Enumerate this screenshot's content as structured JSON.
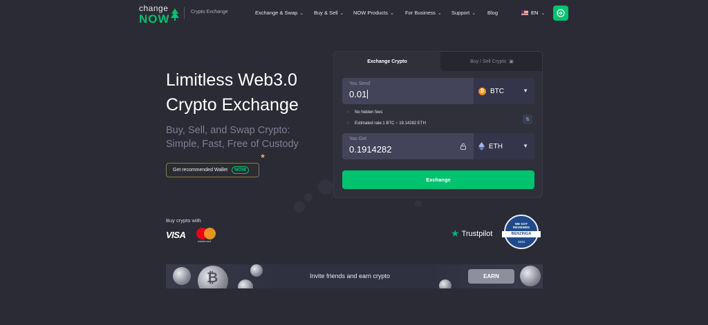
{
  "brand": {
    "logo_top": "change",
    "logo_bottom": "NOW",
    "tagline": "Crypto Exchange",
    "accent_color": "#00c26f"
  },
  "nav": {
    "items": [
      {
        "label": "Exchange & Swap",
        "has_dropdown": true
      },
      {
        "label": "Buy & Sell",
        "has_dropdown": true
      },
      {
        "label": "NOW Products",
        "has_dropdown": true
      },
      {
        "label": "For Business",
        "has_dropdown": true
      },
      {
        "label": "Support",
        "has_dropdown": true
      },
      {
        "label": "Blog",
        "has_dropdown": false
      }
    ],
    "language": "EN"
  },
  "hero": {
    "title_line1": "Limitless Web3.0",
    "title_line2": "Crypto Exchange",
    "subtitle_line1": "Buy, Sell, and Swap Crypto:",
    "subtitle_line2": "Simple, Fast, Free of Custody",
    "wallet_button": "Get recommended Wallet",
    "wallet_badge": "NOW"
  },
  "payments": {
    "label": "Buy crypto with",
    "visa": "VISA",
    "mastercard": "mastercard"
  },
  "exchange": {
    "tabs": [
      "Exchange Crypto",
      "Buy / Sell Crypto"
    ],
    "active_tab": "Exchange Crypto",
    "send": {
      "label": "You Send",
      "value": "0.01",
      "currency": "BTC",
      "currency_icon": "bitcoin-icon"
    },
    "info": {
      "fees": "No hidden fees",
      "rate": "Estimated rate:1 BTC ~ 19.14282 ETH"
    },
    "get": {
      "label": "You Get",
      "value": "0.1914282",
      "currency": "ETH",
      "currency_icon": "ethereum-icon"
    },
    "button": "Exchange"
  },
  "trust": {
    "trustpilot": "Trustpilot",
    "badge_line1": "WE GOT",
    "badge_line2": "REVIEWED",
    "badge_name": "BENZINGA",
    "badge_year": "2023"
  },
  "banner": {
    "text": "Invite friends and earn crypto",
    "button": "EARN"
  }
}
